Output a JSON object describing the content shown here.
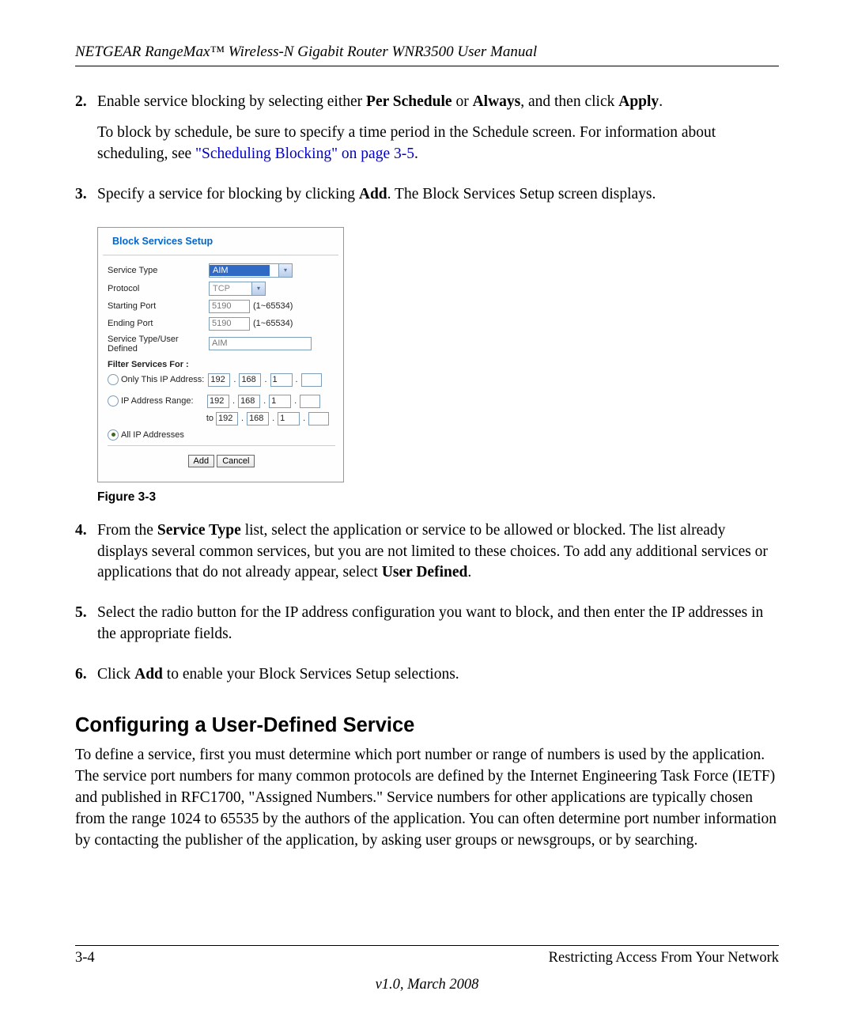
{
  "header": "NETGEAR RangeMax™ Wireless-N Gigabit Router WNR3500 User Manual",
  "steps": {
    "s2": {
      "num": "2.",
      "p1_a": "Enable service blocking by selecting either ",
      "p1_b": "Per Schedule",
      "p1_c": " or ",
      "p1_d": "Always",
      "p1_e": ", and then click ",
      "p1_f": "Apply",
      "p1_g": ".",
      "p2_a": "To block by schedule, be sure to specify a time period in the Schedule screen. For information about scheduling, see ",
      "p2_link": "\"Scheduling Blocking\" on page 3-5",
      "p2_b": "."
    },
    "s3": {
      "num": "3.",
      "p1_a": "Specify a service for blocking by clicking ",
      "p1_b": "Add",
      "p1_c": ". The Block Services Setup screen displays."
    },
    "s4": {
      "num": "4.",
      "p1_a": "From the ",
      "p1_b": "Service Type",
      "p1_c": " list, select the application or service to be allowed or blocked. The list already displays several common services, but you are not limited to these choices. To add any additional services or applications that do not already appear, select ",
      "p1_d": "User Defined",
      "p1_e": "."
    },
    "s5": {
      "num": "5.",
      "p1": "Select the radio button for the IP address configuration you want to block, and then enter the IP addresses in the appropriate fields."
    },
    "s6": {
      "num": "6.",
      "p1_a": "Click ",
      "p1_b": "Add",
      "p1_c": " to enable your Block Services Setup selections."
    }
  },
  "figure": {
    "title": "Block Services Setup",
    "labels": {
      "service_type": "Service Type",
      "protocol": "Protocol",
      "starting_port": "Starting Port",
      "ending_port": "Ending Port",
      "user_defined": "Service Type/User Defined",
      "filter_for": "Filter Services For :",
      "only_this_ip": "Only This IP Address:",
      "ip_range": "IP Address Range:",
      "to": "to",
      "all_ip": "All IP Addresses"
    },
    "values": {
      "service_type": "AIM",
      "protocol": "TCP",
      "starting_port": "5190",
      "ending_port": "5190",
      "user_defined": "AIM",
      "port_range": "(1~65534)",
      "ip1": "192",
      "ip2": "168",
      "ip3": "1"
    },
    "buttons": {
      "add": "Add",
      "cancel": "Cancel"
    },
    "caption": "Figure 3-3"
  },
  "section": {
    "heading": "Configuring a User-Defined Service",
    "para": "To define a service, first you must determine which port number or range of numbers is used by the application. The service port numbers for many common protocols are defined by the Internet Engineering Task Force (IETF) and published in RFC1700, \"Assigned Numbers.\" Service numbers for other applications are typically chosen from the range 1024 to 65535 by the authors of the application. You can often determine port number information by contacting the publisher of the application, by asking user groups or newsgroups, or by searching."
  },
  "footer": {
    "pagenum": "3-4",
    "chapter": "Restricting Access From Your Network",
    "version": "v1.0, March 2008"
  }
}
